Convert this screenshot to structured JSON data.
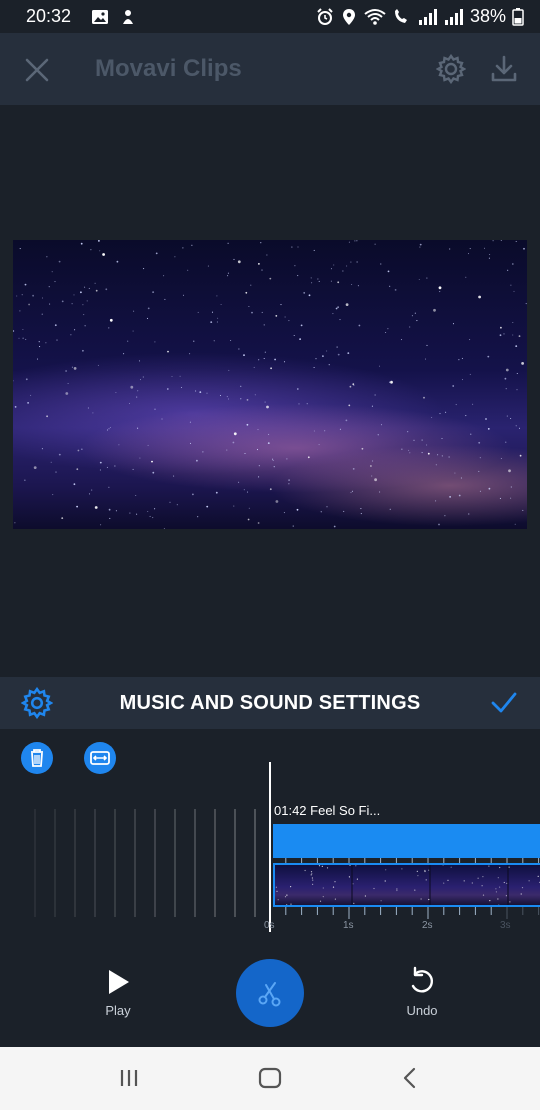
{
  "status_bar": {
    "time": "20:32",
    "battery": "38%"
  },
  "app_bar": {
    "title": "Movavi Clips"
  },
  "settings_bar": {
    "title": "MUSIC AND SOUND SETTINGS"
  },
  "timeline": {
    "audio_clip_label": "01:42 Feel So Fi...",
    "ruler_labels": [
      "0s",
      "1s",
      "2s",
      "3s"
    ]
  },
  "controls": {
    "play_label": "Play",
    "undo_label": "Undo"
  },
  "colors": {
    "accent": "#1f86ee",
    "background": "#1b2129",
    "bar": "#262f3c"
  }
}
